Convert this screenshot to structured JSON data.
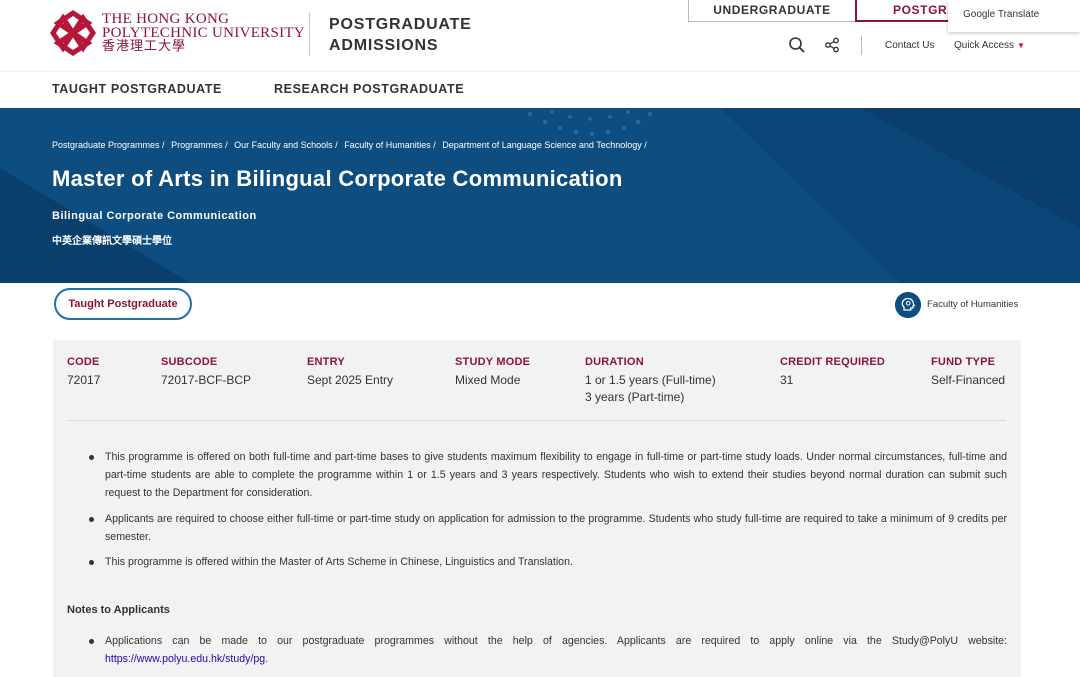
{
  "header": {
    "logo": {
      "line1": "THE HONG KONG",
      "line2": "POLYTECHNIC UNIVERSITY",
      "line3": "香港理工大學"
    },
    "section_title_line1": "POSTGRADUATE",
    "section_title_line2": "ADMISSIONS",
    "tabs": {
      "undergraduate": "UNDERGRADUATE",
      "postgraduate": "POSTGRADUATE"
    },
    "google_translate": "Google Translate",
    "contact_us": "Contact Us",
    "quick_access": "Quick Access"
  },
  "nav": {
    "items": [
      {
        "label": "TAUGHT POSTGRADUATE"
      },
      {
        "label": "RESEARCH POSTGRADUATE"
      }
    ]
  },
  "hero": {
    "breadcrumbs": [
      "Postgraduate Programmes /",
      "Programmes /",
      "Our Faculty and Schools /",
      "Faculty of Humanities /",
      "Department of Language Science and Technology /"
    ],
    "title": "Master of Arts in Bilingual Corporate Communication",
    "subtitle": "Bilingual Corporate Communication",
    "chinese_title": "中英企業傳訊文學碩士學位"
  },
  "badges": {
    "category": "Taught Postgraduate",
    "faculty": "Faculty of Humanities"
  },
  "programme": {
    "code": {
      "label": "CODE",
      "value": "72017"
    },
    "subcode": {
      "label": "SUBCODE",
      "value": "72017-BCF-BCP"
    },
    "entry": {
      "label": "ENTRY",
      "value": "Sept 2025 Entry"
    },
    "study_mode": {
      "label": "STUDY MODE",
      "value": "Mixed Mode"
    },
    "duration": {
      "label": "DURATION",
      "value_line1": "1 or 1.5 years (Full-time)",
      "value_line2": "3 years (Part-time)"
    },
    "credit_required": {
      "label": "CREDIT REQUIRED",
      "value": "31"
    },
    "fund_type": {
      "label": "FUND TYPE",
      "value": "Self-Financed"
    }
  },
  "description": [
    "This programme is offered on both full-time and part-time bases to give students maximum flexibility to engage in full-time or part-time study loads. Under normal circumstances, full-time and part-time students are able to complete the programme within 1 or 1.5 years and 3 years respectively. Students who wish to extend their studies beyond normal duration can submit such request to the Department for consideration.",
    "Applicants are required to choose either full-time or part-time study on application for admission to the programme. Students who study full-time are required to take a minimum of 9 credits per semester.",
    "This programme is offered within the Master of Arts Scheme in Chinese, Linguistics and Translation."
  ],
  "notes": {
    "heading": "Notes to Applicants",
    "item1_text": "Applications can be made to our postgraduate programmes without the help of agencies. Applicants are required to apply online via the Study@PolyU website:",
    "item1_link": "https://www.polyu.edu.hk/study/pg",
    "item1_end": "."
  },
  "colors": {
    "brand_maroon": "#8a1538",
    "hero_blue": "#0e4d80",
    "pill_border": "#1f6fb3",
    "panel_bg": "#f2f2f2"
  }
}
